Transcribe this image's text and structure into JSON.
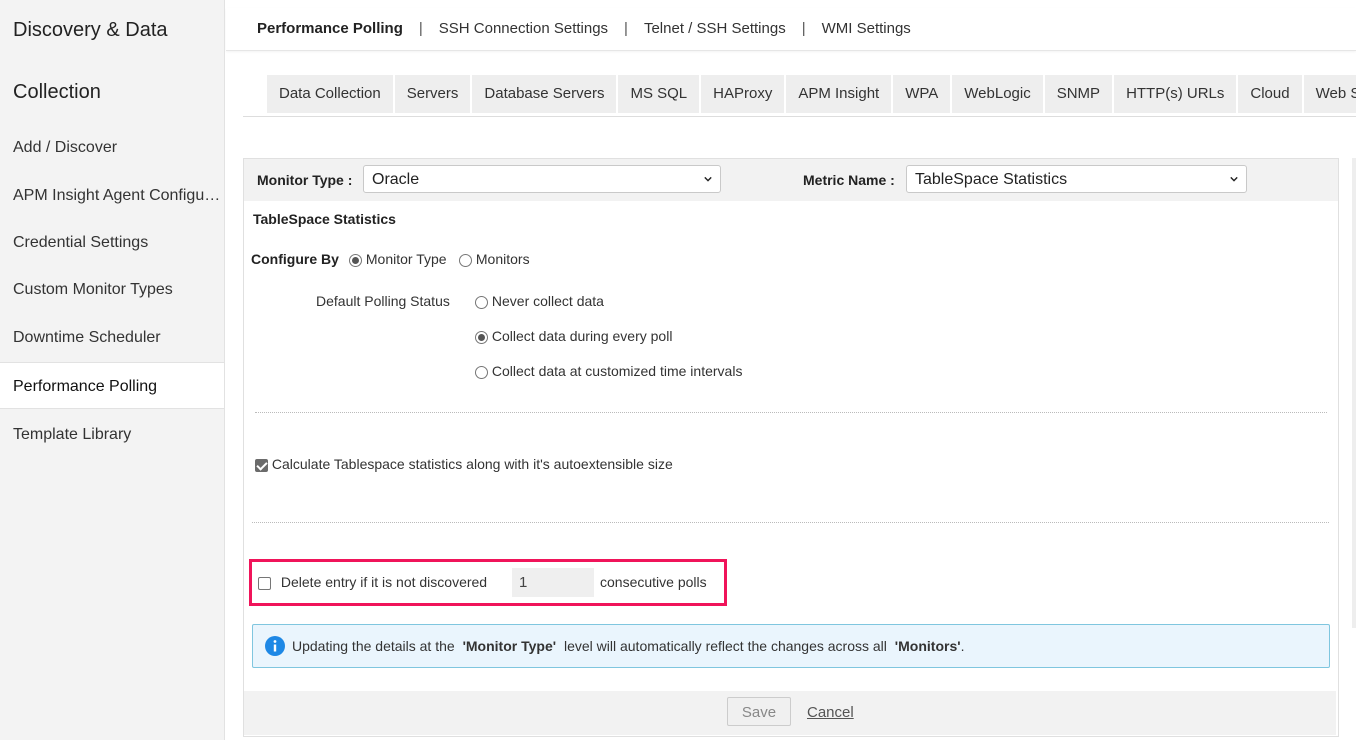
{
  "sidebar": {
    "title_line1": "Discovery & Data",
    "title_line2": "Collection",
    "items": [
      {
        "label": "Add / Discover"
      },
      {
        "label": "APM Insight Agent Configuration"
      },
      {
        "label": "Credential Settings"
      },
      {
        "label": "Custom Monitor Types"
      },
      {
        "label": "Downtime Scheduler"
      },
      {
        "label": "Performance Polling",
        "active": true
      },
      {
        "label": "Template Library"
      }
    ]
  },
  "topnav": {
    "items": [
      {
        "label": "Performance Polling",
        "active": true
      },
      {
        "label": "SSH Connection Settings"
      },
      {
        "label": "Telnet / SSH Settings"
      },
      {
        "label": "WMI Settings"
      }
    ],
    "separator": "|"
  },
  "tabs": [
    {
      "label": "Data Collection"
    },
    {
      "label": "Servers"
    },
    {
      "label": "Database Servers"
    },
    {
      "label": "MS SQL"
    },
    {
      "label": "HAProxy"
    },
    {
      "label": "APM Insight"
    },
    {
      "label": "WPA"
    },
    {
      "label": "WebLogic"
    },
    {
      "label": "SNMP"
    },
    {
      "label": "HTTP(s) URLs"
    },
    {
      "label": "Cloud"
    },
    {
      "label": "Web Ser"
    }
  ],
  "form": {
    "monitor_type_label": "Monitor Type :",
    "monitor_type_value": "Oracle",
    "metric_name_label": "Metric Name :",
    "metric_name_value": "TableSpace Statistics",
    "section_title": "TableSpace Statistics",
    "configure_by_label": "Configure By",
    "configure_by_options": [
      "Monitor Type",
      "Monitors"
    ],
    "configure_by_selected": "Monitor Type",
    "polling_status_label": "Default Polling Status",
    "polling_options": [
      "Never collect data",
      "Collect data during every poll",
      "Collect data at customized time intervals"
    ],
    "polling_selected": "Collect data during every poll",
    "autoextensible_label": "Calculate Tablespace statistics along with it's autoextensible size",
    "autoextensible_checked": true,
    "delete_entry_label": "Delete entry if it is not discovered",
    "delete_entry_checked": false,
    "delete_entry_value": "1",
    "consecutive_label": "consecutive polls",
    "info_part1": "Updating the details at the",
    "info_bold1": "'Monitor Type'",
    "info_part2": "level will automatically reflect the changes across all",
    "info_bold2": "'Monitors'",
    "info_end": ".",
    "save_label": "Save",
    "cancel_label": "Cancel"
  },
  "colors": {
    "highlight_border": "#f0145a",
    "info_icon": "#1e88e5",
    "info_bg": "#eaf5fd"
  }
}
